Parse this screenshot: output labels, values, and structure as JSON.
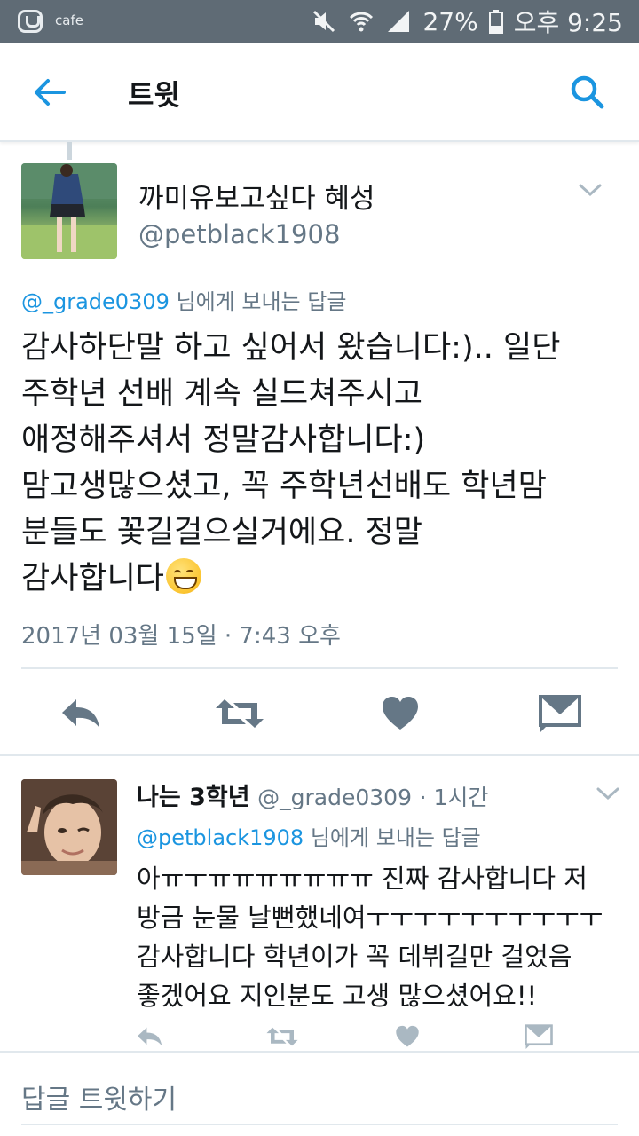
{
  "status_bar": {
    "app_name": "cafe",
    "battery": "27%",
    "time": "오후 9:25"
  },
  "header": {
    "title": "트윗"
  },
  "main_tweet": {
    "display_name": "까미유보고싶다 혜성",
    "handle": "@petblack1908",
    "reply_to_handle": "@_grade0309",
    "reply_context_suffix": " 님에게 보내는 답글",
    "text_lines": [
      "감사하단말 하고 싶어서 왔습니다:).. 일단",
      "주학년 선배 계속 실드쳐주시고",
      "애정해주셔서 정말감사합니다:)",
      "맘고생많으셨고, 꼭 주학년선배도 학년맘",
      "분들도 꽃길걸으실거에요. 정말",
      "감사합니다"
    ],
    "timestamp": "2017년 03월 15일 · 7:43 오후"
  },
  "reply_tweet": {
    "display_name": "나는 3학년",
    "handle": "@_grade0309",
    "time_ago": "· 1시간",
    "reply_to_handle": "@petblack1908",
    "reply_context_suffix": " 님에게 보내는 답글",
    "text_lines": [
      "아ㅠㅜㅠㅠㅠㅠㅠㅠㅠ 진짜 감사합니다 저",
      "방금 눈물 날뻔했네여ㅜㅜㅜㅜㅜㅜㅜㅜㅜㅜ",
      "감사합니다 학년이가 꼭 데뷔길만 걸었음",
      "좋겠어요 지인분도 고생 많으셨어요!!"
    ]
  },
  "compose": {
    "placeholder": "답글 트윗하기"
  },
  "icons": {
    "back": "arrow-left-icon",
    "search": "search-icon",
    "reply": "reply-icon",
    "retweet": "retweet-icon",
    "like": "heart-icon",
    "dm": "envelope-icon",
    "more": "chevron-down-icon"
  },
  "colors": {
    "accent": "#1b95e0",
    "status_bar": "#5f6b75",
    "secondary_text": "#657786",
    "action_icon": "#657786",
    "divider": "#e1e8ed"
  }
}
